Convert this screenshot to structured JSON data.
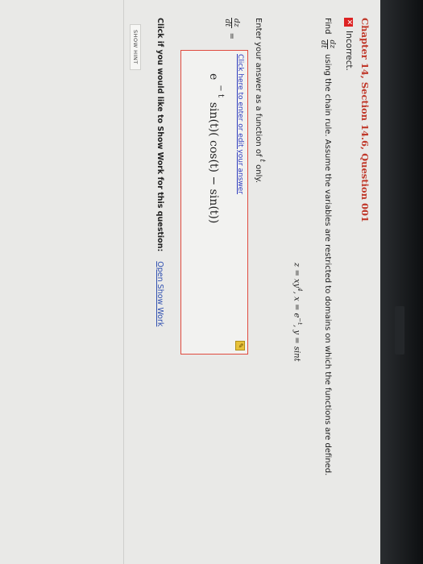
{
  "question": {
    "title": "Chapter 14, Section 14.6, Question 001",
    "status": "Incorrect.",
    "find_word": "Find",
    "derivative_num": "dz",
    "derivative_den": "dt",
    "instruction": "using the chain rule. Assume the variables are restricted to domains on which the functions are defined.",
    "equation_parts": {
      "z": "z = xy",
      "z_exp": "4",
      "x": ", x = e",
      "x_exp": "−t",
      "y": ", y = sint"
    },
    "enter_prefix": "Enter your answer as a function of",
    "enter_var": "t",
    "enter_suffix": "only."
  },
  "answer": {
    "label_num": "dz",
    "label_den": "dt",
    "equals": "=",
    "edit_link": "Click here to enter or edit your answer",
    "edit_icon": "pencil-icon",
    "expr_base": "e",
    "expr_exp": "− t",
    "expr_body": "sin(t)( cos(t) − sin(t))"
  },
  "show_work": {
    "prompt": "Click if you would like to Show Work for this question:",
    "link": "Open Show Work"
  },
  "hint_button": "SHOW HINT",
  "colors": {
    "title": "#c0392b",
    "answer_border": "#e04b3f",
    "link": "#2e3bbd"
  }
}
